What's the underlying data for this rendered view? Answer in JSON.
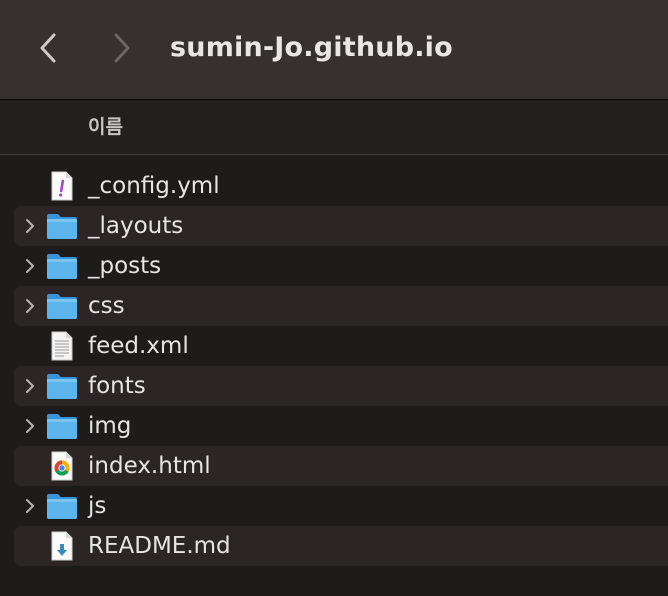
{
  "window": {
    "title": "sumin-Jo.github.io"
  },
  "toolbar": {
    "back_icon": "chevron-left-icon",
    "forward_icon": "chevron-right-icon"
  },
  "columns": {
    "name_label": "이름"
  },
  "files": [
    {
      "name": "_config.yml",
      "kind": "yml",
      "icon": "yaml-file-icon",
      "expandable": false
    },
    {
      "name": "_layouts",
      "kind": "folder",
      "icon": "folder-icon",
      "expandable": true
    },
    {
      "name": "_posts",
      "kind": "folder",
      "icon": "folder-icon",
      "expandable": true
    },
    {
      "name": "css",
      "kind": "folder",
      "icon": "folder-icon",
      "expandable": true
    },
    {
      "name": "feed.xml",
      "kind": "xml",
      "icon": "xml-file-icon",
      "expandable": false
    },
    {
      "name": "fonts",
      "kind": "folder",
      "icon": "folder-icon",
      "expandable": true
    },
    {
      "name": "img",
      "kind": "folder",
      "icon": "folder-icon",
      "expandable": true
    },
    {
      "name": "index.html",
      "kind": "html",
      "icon": "chrome-html-file-icon",
      "expandable": false
    },
    {
      "name": "js",
      "kind": "folder",
      "icon": "folder-icon",
      "expandable": true
    },
    {
      "name": "README.md",
      "kind": "md",
      "icon": "markdown-file-icon",
      "expandable": false
    }
  ],
  "colors": {
    "toolbar_bg": "#363130",
    "list_bg": "#1e1b1b",
    "alt_row_bg": "#2b2625",
    "folder_blue": "#4aa9e6"
  }
}
